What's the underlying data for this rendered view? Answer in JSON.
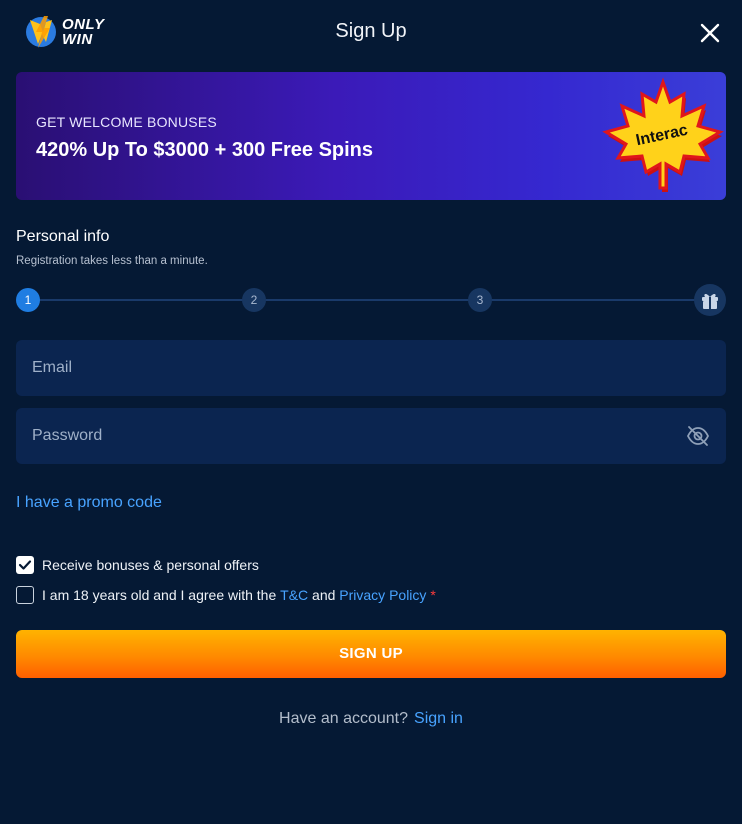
{
  "header": {
    "logo_line1": "ONLY",
    "logo_line2": "WIN",
    "title": "Sign Up",
    "close_icon": "close-icon"
  },
  "banner": {
    "subtitle": "GET WELCOME BONUSES",
    "headline": "420% Up To $3000 + 300 Free Spins",
    "badge_text": "Interac",
    "badge_icon": "maple-leaf-icon"
  },
  "personal_info": {
    "title": "Personal info",
    "subtitle": "Registration takes less than a minute."
  },
  "stepper": {
    "steps": [
      "1",
      "2",
      "3"
    ],
    "active_step": 1,
    "final_icon": "gift-icon"
  },
  "form": {
    "email_placeholder": "Email",
    "password_placeholder": "Password",
    "password_toggle_icon": "eye-off-icon"
  },
  "promo": {
    "label": "I have a promo code"
  },
  "checkboxes": {
    "bonuses": {
      "label": "Receive bonuses & personal offers",
      "checked": true
    },
    "terms": {
      "prefix": "I am 18 years old and I agree with the",
      "tc_link": "T&C",
      "and": "and",
      "privacy_link": "Privacy Policy",
      "required_mark": "*",
      "checked": false
    }
  },
  "signup_button": {
    "label": "SIGN UP"
  },
  "footer": {
    "question": "Have an account?",
    "signin_link": "Sign in"
  },
  "colors": {
    "background": "#051934",
    "field": "#0b2550",
    "link": "#48a3ff",
    "button_top": "#ffb300",
    "button_bottom": "#ff5f00",
    "step_active": "#1f7de2"
  }
}
